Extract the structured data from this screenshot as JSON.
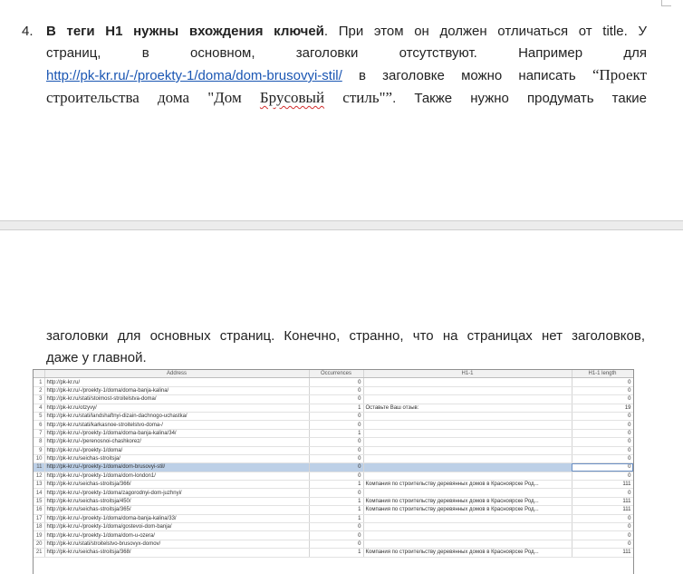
{
  "item": {
    "number": "4.",
    "bold": "В теги H1 нужны вхождения ключей",
    "line1_rest": ". При этом он должен отличаться от title. У",
    "line2": "страниц, в основном, заголовки отсутствуют. Например для",
    "link": "http://pk-kr.ru/-/proekty-1/doma/dom-brusovyi-stil/",
    "line3_rest": "в заголовке можно написать",
    "quote_open": "“Проект",
    "line4_serif": "строительства дома \"Дом ",
    "spell_word": "Брусовый",
    "line4_serif_end": " стиль\"”",
    "line4_rest": ". Также нужно продумать такие"
  },
  "continuation": {
    "line1": "заголовки для основных страниц. Конечно, странно, что на страницах нет заголовков,",
    "line2": "даже у главной."
  },
  "sheet": {
    "columns": [
      "",
      "Address",
      "Occurrences",
      "H1-1",
      "H1-1 length"
    ],
    "rows": [
      {
        "n": "1",
        "address": "http://pk-kr.ru/",
        "occ": "0",
        "h1": "",
        "len": "0"
      },
      {
        "n": "2",
        "address": "http://pk-kr.ru/-/proekty-1/doma/doma-banja-kalina/",
        "occ": "0",
        "h1": "",
        "len": "0"
      },
      {
        "n": "3",
        "address": "http://pk-kr.ru/stati/stoimost-stroitelstva-doma/",
        "occ": "0",
        "h1": "",
        "len": "0"
      },
      {
        "n": "4",
        "address": "http://pk-kr.ru/otzyvy/",
        "occ": "1",
        "h1": "Оставьте Ваш отзыв:",
        "len": "19"
      },
      {
        "n": "5",
        "address": "http://pk-kr.ru/stati/landshaftnyi-dizain-dachnogo-uchastka/",
        "occ": "0",
        "h1": "",
        "len": "0"
      },
      {
        "n": "6",
        "address": "http://pk-kr.ru/stati/karkasnoe-stroitelstvo-doma-/",
        "occ": "0",
        "h1": "",
        "len": "0"
      },
      {
        "n": "7",
        "address": "http://pk-kr.ru/-/proekty-1/doma/doma-banja-kalina/34/",
        "occ": "1",
        "h1": "",
        "len": "0"
      },
      {
        "n": "8",
        "address": "http://pk-kr.ru/-/perenosnoi-chashkorez/",
        "occ": "0",
        "h1": "",
        "len": "0"
      },
      {
        "n": "9",
        "address": "http://pk-kr.ru/-/proekty-1/doma/",
        "occ": "0",
        "h1": "",
        "len": "0"
      },
      {
        "n": "10",
        "address": "http://pk-kr.ru/seichas-stroitsja/",
        "occ": "0",
        "h1": "",
        "len": "0"
      },
      {
        "n": "11",
        "address": "http://pk-kr.ru/-/proekty-1/doma/dom-brusovyi-stil/",
        "occ": "0",
        "h1": "",
        "len": "0",
        "selected": true
      },
      {
        "n": "12",
        "address": "http://pk-kr.ru/-/proekty-1/doma/dom-london1/",
        "occ": "0",
        "h1": "",
        "len": "0"
      },
      {
        "n": "13",
        "address": "http://pk-kr.ru/seichas-stroitsja/366/",
        "occ": "1",
        "h1": "Компания по строительству деревянных домов в Красноярске Род...",
        "len": "111"
      },
      {
        "n": "14",
        "address": "http://pk-kr.ru/-/proekty-1/doma/zagorodnyi-dom-juzhnyi/",
        "occ": "0",
        "h1": "",
        "len": "0"
      },
      {
        "n": "15",
        "address": "http://pk-kr.ru/seichas-stroitsja/450/",
        "occ": "1",
        "h1": "Компания по строительству деревянных домов в Красноярске Род...",
        "len": "111"
      },
      {
        "n": "16",
        "address": "http://pk-kr.ru/seichas-stroitsja/365/",
        "occ": "1",
        "h1": "Компания по строительству деревянных домов в Красноярске Род...",
        "len": "111"
      },
      {
        "n": "17",
        "address": "http://pk-kr.ru/-/proekty-1/doma/doma-banja-kalina/33/",
        "occ": "1",
        "h1": "",
        "len": "0"
      },
      {
        "n": "18",
        "address": "http://pk-kr.ru/-/proekty-1/doma/gostevoi-dom-banja/",
        "occ": "0",
        "h1": "",
        "len": "0"
      },
      {
        "n": "19",
        "address": "http://pk-kr.ru/-/proekty-1/doma/dom-u-ozera/",
        "occ": "0",
        "h1": "",
        "len": "0"
      },
      {
        "n": "20",
        "address": "http://pk-kr.ru/stati/stroitelstvo-brusovyx-domov/",
        "occ": "0",
        "h1": "",
        "len": "0"
      },
      {
        "n": "21",
        "address": "http://pk-kr.ru/seichas-stroitsja/368/",
        "occ": "1",
        "h1": "Компания по строительству деревянных домов в Красноярске Род...",
        "len": "111"
      }
    ]
  }
}
